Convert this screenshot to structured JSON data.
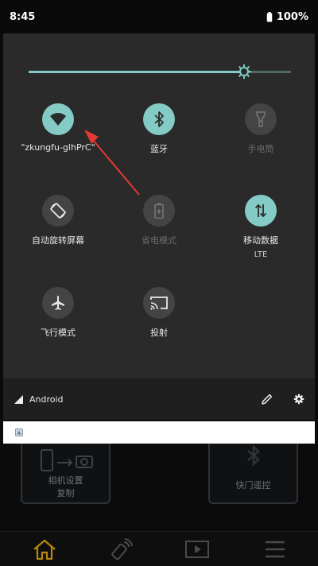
{
  "status_bar": {
    "time": "8:45",
    "battery": "100%"
  },
  "brightness": {
    "level": 0.82
  },
  "tiles": [
    {
      "id": "wifi",
      "label": "\"zkungfu-glhPrC\"",
      "sublabel": "",
      "state": "on",
      "icon": "wifi-icon"
    },
    {
      "id": "bluetooth",
      "label": "蓝牙",
      "sublabel": "",
      "state": "on",
      "icon": "bluetooth-icon"
    },
    {
      "id": "flashlight",
      "label": "手电筒",
      "sublabel": "",
      "state": "disabled",
      "icon": "flashlight-icon"
    },
    {
      "id": "auto_rotate",
      "label": "自动旋转屏幕",
      "sublabel": "",
      "state": "off",
      "icon": "rotate-icon"
    },
    {
      "id": "battery_saver",
      "label": "省电模式",
      "sublabel": "",
      "state": "disabled",
      "icon": "battery-saver-icon"
    },
    {
      "id": "mobile_data",
      "label": "移动数据",
      "sublabel": "LTE",
      "state": "on",
      "icon": "mobile-data-icon"
    },
    {
      "id": "airplane",
      "label": "飞行模式",
      "sublabel": "",
      "state": "off",
      "icon": "airplane-icon"
    },
    {
      "id": "cast",
      "label": "投射",
      "sublabel": "",
      "state": "off",
      "icon": "cast-icon"
    }
  ],
  "footer": {
    "carrier": "Android"
  },
  "background_app": {
    "camera_card": {
      "line1": "相机设置",
      "line2": "复制"
    },
    "remote_card": {
      "label": "快门遥控"
    }
  },
  "colors": {
    "accent": "#84cbc5",
    "panel": "#2a2a2a",
    "arrow": "#e53935"
  }
}
